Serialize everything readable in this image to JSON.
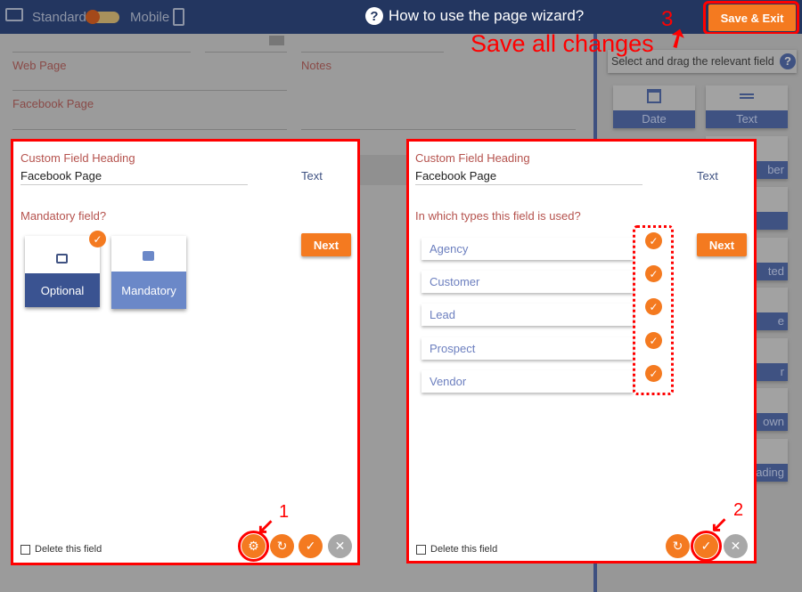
{
  "header": {
    "standard_label": "Standard",
    "mobile_label": "Mobile",
    "title": "How to use the page wizard?",
    "save_label": "Save & Exit"
  },
  "background_form": {
    "web_page_label": "Web Page",
    "notes_label": "Notes",
    "facebook_label": "Facebook Page"
  },
  "side_panel": {
    "hint": "Select and drag the relevant field",
    "tiles": [
      "Date",
      "Text",
      "ber",
      "",
      "ted",
      "e",
      "r",
      "own",
      "ading"
    ]
  },
  "left_card": {
    "heading_label": "Custom Field Heading",
    "heading_value": "Facebook Page",
    "type": "Text",
    "mandatory_question": "Mandatory field?",
    "options": [
      {
        "label": "Optional",
        "selected": true
      },
      {
        "label": "Mandatory",
        "selected": false
      }
    ],
    "next_label": "Next",
    "delete_label": "Delete this field"
  },
  "right_card": {
    "heading_label": "Custom Field Heading",
    "heading_value": "Facebook Page",
    "type": "Text",
    "types_question": "In which types this field is used?",
    "types": [
      {
        "label": "Agency",
        "checked": true
      },
      {
        "label": "Customer",
        "checked": true
      },
      {
        "label": "Lead",
        "checked": true
      },
      {
        "label": "Prospect",
        "checked": true
      },
      {
        "label": "Vendor",
        "checked": true
      }
    ],
    "next_label": "Next",
    "delete_label": "Delete this field"
  },
  "annotations": {
    "step1": "1",
    "step2": "2",
    "step3": "3",
    "save_note": "Save all changes"
  },
  "colors": {
    "header": "#233660",
    "accent": "#f47a20",
    "primary": "#3f5282",
    "annotation": "#ff0000"
  }
}
